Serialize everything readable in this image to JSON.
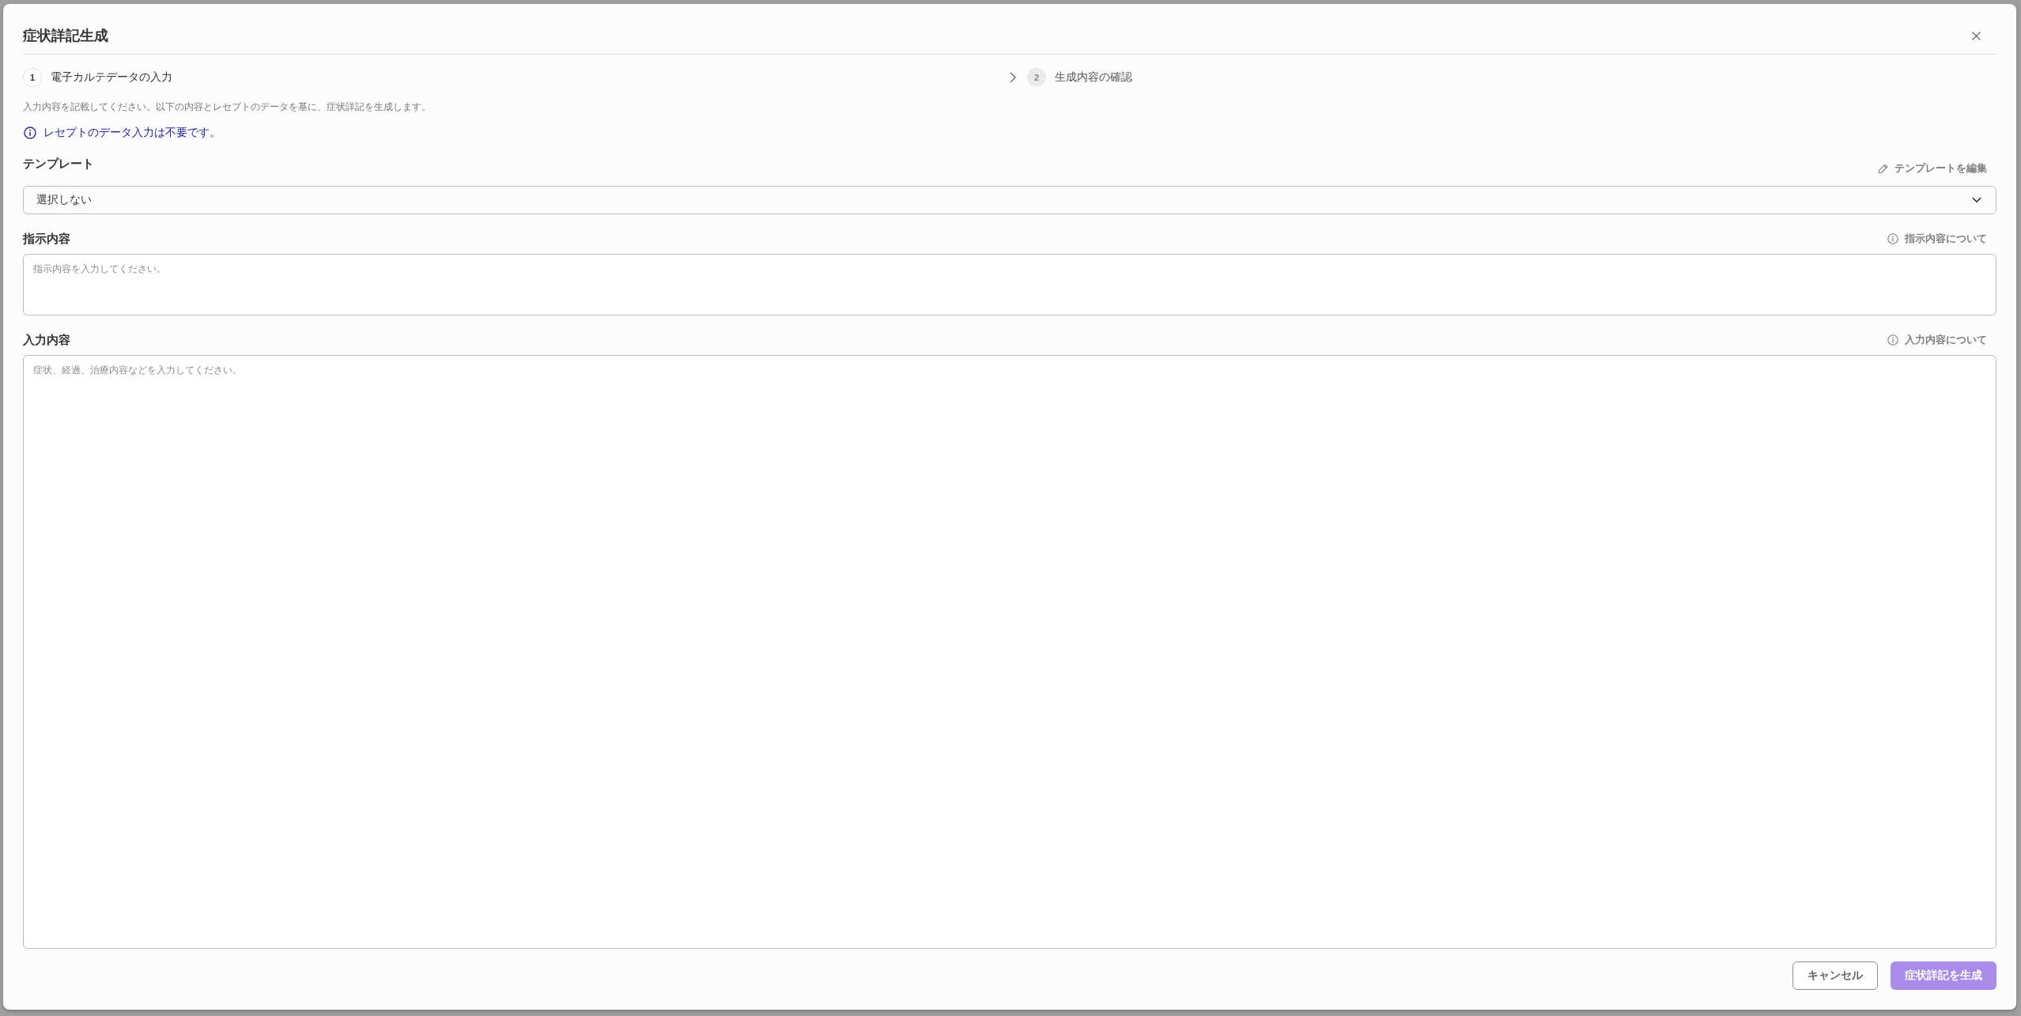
{
  "dialog": {
    "title": "症状詳記生成"
  },
  "steps": [
    {
      "number": "1",
      "label": "電子カルテデータの入力",
      "selected": true
    },
    {
      "number": "2",
      "label": "生成内容の確認",
      "selected": false
    }
  ],
  "description": "入力内容を記載してください。以下の内容とレセプトのデータを基に、症状詳記を生成します。",
  "notice": "レセプトのデータ入力は不要です。",
  "fields": [
    {
      "kind": "select",
      "label": "テンプレート",
      "action": {
        "kind": "edit",
        "label": "テンプレートを編集"
      },
      "value": "選択しない"
    },
    {
      "kind": "textarea",
      "label": "指示内容",
      "action": {
        "kind": "info",
        "label": "指示内容について"
      },
      "placeholder": "指示内容を入力してください。"
    },
    {
      "kind": "textarea",
      "label": "入力内容",
      "action": {
        "kind": "info",
        "label": "入力内容について"
      },
      "placeholder": "症状、経過、治療内容などを入力してください。"
    }
  ],
  "buttons": [
    {
      "kind": "secondary",
      "label": "キャンセル",
      "disabled": false
    },
    {
      "kind": "primary",
      "label": "症状詳記を生成",
      "disabled": true
    }
  ]
}
